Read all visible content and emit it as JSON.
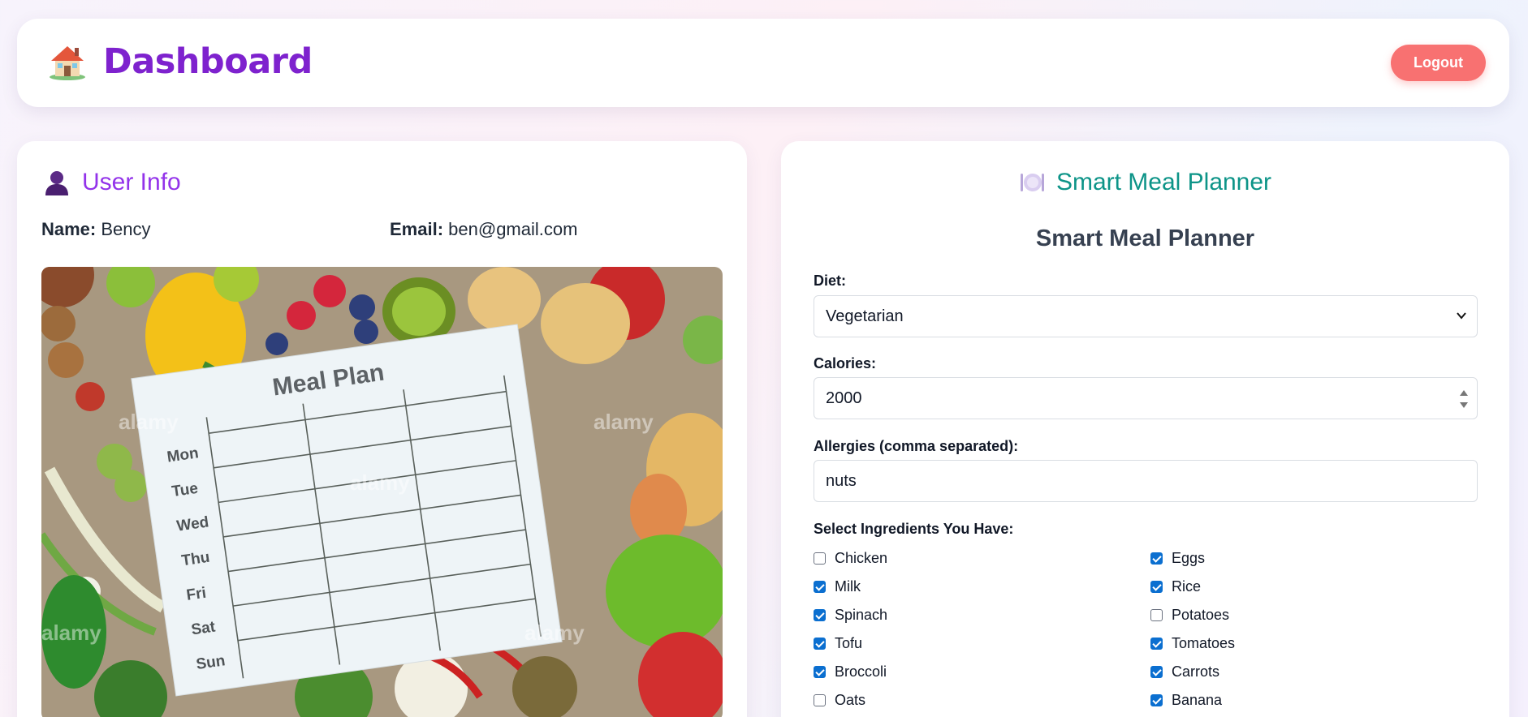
{
  "header": {
    "title": "Dashboard",
    "icon": "house-icon",
    "logout_label": "Logout"
  },
  "user_info": {
    "title": "User Info",
    "icon": "user-icon",
    "name_label": "Name:",
    "name_value": "Bency",
    "email_label": "Email:",
    "email_value": "ben@gmail.com",
    "image": {
      "heading": "Meal Plan",
      "days": [
        "Mon",
        "Tue",
        "Wed",
        "Thu",
        "Fri",
        "Sat",
        "Sun"
      ],
      "watermark": "alamy"
    }
  },
  "planner": {
    "title": "Smart Meal Planner",
    "icon": "plate-icon",
    "subtitle": "Smart Meal Planner",
    "diet_label": "Diet:",
    "diet_value": "Vegetarian",
    "calories_label": "Calories:",
    "calories_value": "2000",
    "allergies_label": "Allergies (comma separated):",
    "allergies_value": "nuts",
    "ingredients_label": "Select Ingredients You Have:",
    "ingredients": [
      {
        "label": "Chicken",
        "checked": false
      },
      {
        "label": "Eggs",
        "checked": true
      },
      {
        "label": "Milk",
        "checked": true
      },
      {
        "label": "Rice",
        "checked": true
      },
      {
        "label": "Spinach",
        "checked": true
      },
      {
        "label": "Potatoes",
        "checked": false
      },
      {
        "label": "Tofu",
        "checked": true
      },
      {
        "label": "Tomatoes",
        "checked": true
      },
      {
        "label": "Broccoli",
        "checked": true
      },
      {
        "label": "Carrots",
        "checked": true
      },
      {
        "label": "Oats",
        "checked": false
      },
      {
        "label": "Banana",
        "checked": true
      }
    ]
  },
  "colors": {
    "brand": "#7e22ce",
    "user_title": "#9333ea",
    "planner_title": "#0d9488",
    "logout": "#f87171",
    "checkbox": "#0b6fd0"
  }
}
